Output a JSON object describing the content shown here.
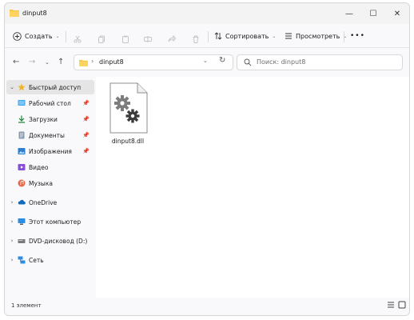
{
  "window": {
    "title": "dinput8",
    "controls": {
      "minimize": "—",
      "maximize": "☐",
      "close": "✕"
    }
  },
  "commandbar": {
    "create_label": "Создать",
    "sort_label": "Сортировать",
    "view_label": "Просмотреть",
    "more_label": "•••",
    "caret": "⌄"
  },
  "nav": {
    "back": "←",
    "forward": "→",
    "recent": "⌄",
    "up": "↑"
  },
  "address": {
    "chevron": "›",
    "path": "dinput8",
    "dropdown": "⌄",
    "refresh": "↻"
  },
  "search": {
    "placeholder": "Поиск: dinput8"
  },
  "sidebar": {
    "items": [
      {
        "label": "Быстрый доступ",
        "chevron": "⌄"
      },
      {
        "label": "Рабочий стол",
        "pin": "📌"
      },
      {
        "label": "Загрузки",
        "pin": "📌"
      },
      {
        "label": "Документы",
        "pin": "📌"
      },
      {
        "label": "Изображения",
        "pin": "📌"
      },
      {
        "label": "Видео"
      },
      {
        "label": "Музыка"
      },
      {
        "label": "OneDrive",
        "chevron": "›"
      },
      {
        "label": "Этот компьютер",
        "chevron": "›"
      },
      {
        "label": "DVD-дисковод (D:)",
        "chevron": "›"
      },
      {
        "label": "Сеть",
        "chevron": "›"
      }
    ]
  },
  "files": [
    {
      "name": "dinput8.dll",
      "icon": "settings-file-icon"
    }
  ],
  "status": {
    "count": "1 элемент"
  },
  "colors": {
    "folder": "#f4c542",
    "accent": "#0067c0",
    "gear": "#5c5c5c"
  }
}
